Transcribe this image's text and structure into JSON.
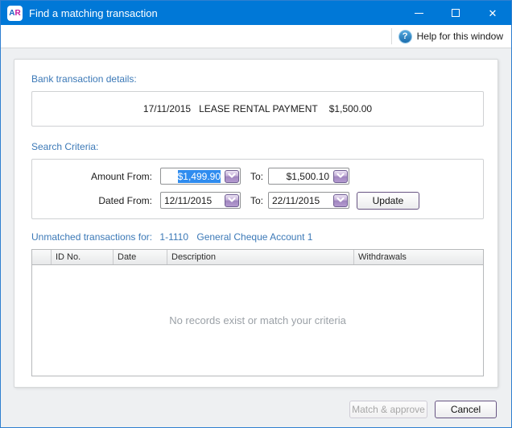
{
  "window": {
    "title": "Find a matching transaction",
    "app_icon": {
      "a": "A",
      "r": "R"
    },
    "controls": {
      "close": "✕"
    }
  },
  "toolbar": {
    "help_icon": "?",
    "help_label": "Help for this window"
  },
  "bank_details": {
    "heading": "Bank transaction details:",
    "date": "17/11/2015",
    "description": "LEASE RENTAL PAYMENT",
    "amount": "$1,500.00"
  },
  "search_criteria": {
    "heading": "Search Criteria:",
    "amount_from_label": "Amount From:",
    "amount_from_value": "$1,499.90",
    "amount_to_label": "To:",
    "amount_to_value": "$1,500.10",
    "dated_from_label": "Dated From:",
    "dated_from_value": "12/11/2015",
    "dated_to_label": "To:",
    "dated_to_value": "22/11/2015",
    "update_button": "Update"
  },
  "unmatched": {
    "heading": "Unmatched transactions for:",
    "account_number": "1-1110",
    "account_name": "General Cheque Account 1",
    "table": {
      "columns": [
        "",
        "ID No.",
        "Date",
        "Description",
        "Withdrawals"
      ],
      "rows": [],
      "empty_message": "No records exist or match your criteria"
    }
  },
  "footer": {
    "match_approve_button": "Match & approve",
    "cancel_button": "Cancel"
  },
  "colors": {
    "titlebar": "#0078d7",
    "heading_blue": "#3c79b7",
    "selection_blue": "#2f8cef",
    "dropdown_purple": "#a086bf",
    "button_border_purple": "#675482"
  }
}
